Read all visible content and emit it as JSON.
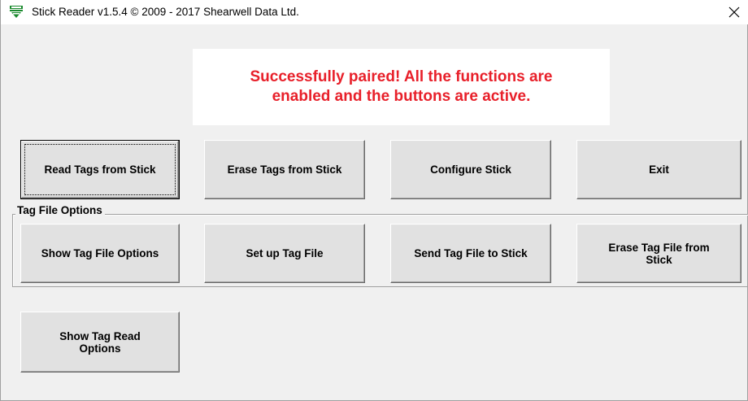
{
  "window": {
    "title": "Stick Reader v1.5.4 © 2009 - 2017 Shearwell Data Ltd.",
    "close_symbol": "✕",
    "icon": "app-icon"
  },
  "status": {
    "message": "Successfully paired! All the functions are\nenabled and the buttons are active.",
    "color": "#e8202a"
  },
  "main_buttons": {
    "read_tags": "Read Tags from Stick",
    "erase_tags": "Erase Tags from Stick",
    "configure": "Configure Stick",
    "exit": "Exit"
  },
  "tag_file_options": {
    "group_label": "Tag File Options",
    "show_options": "Show Tag File Options",
    "setup": "Set up Tag File",
    "send": "Send Tag File to Stick",
    "erase": "Erase Tag File from\nStick"
  },
  "tag_read": {
    "show_options": "Show Tag Read\nOptions"
  }
}
